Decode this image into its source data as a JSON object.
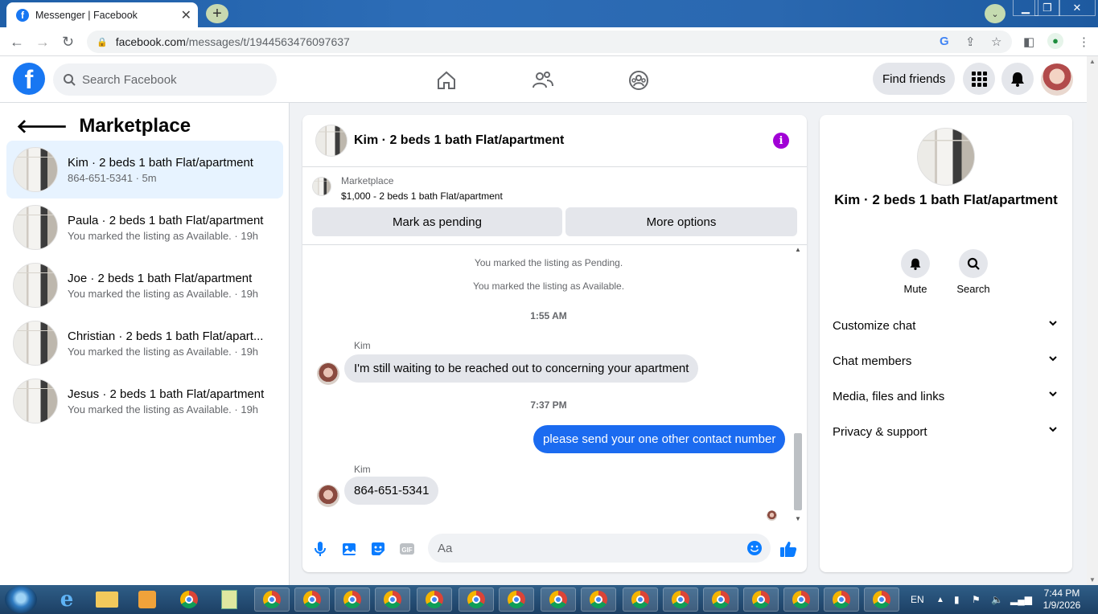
{
  "browser": {
    "tab_title": "Messenger | Facebook",
    "url_host": "facebook.com",
    "url_path": "/messages/t/1944563476097637"
  },
  "header": {
    "search_placeholder": "Search Facebook",
    "find_friends": "Find friends"
  },
  "sidebar": {
    "title": "Marketplace",
    "conversations": [
      {
        "name": "Kim · 2 beds 1 bath Flat/apartment",
        "sub": "864-651-5341 · 5m",
        "active": true
      },
      {
        "name": "Paula · 2 beds 1 bath Flat/apartment",
        "sub": "You marked the listing as Available. · 19h"
      },
      {
        "name": "Joe · 2 beds 1 bath Flat/apartment",
        "sub": "You marked the listing as Available. · 19h"
      },
      {
        "name": "Christian · 2 beds 1 bath Flat/apart...",
        "sub": "You marked the listing as Available. · 19h"
      },
      {
        "name": "Jesus · 2 beds 1 bath Flat/apartment",
        "sub": "You marked the listing as Available. · 19h"
      }
    ]
  },
  "chat": {
    "title": "Kim · 2 beds 1 bath Flat/apartment",
    "listing_label": "Marketplace",
    "listing_detail": "$1,000 - 2 beds 1 bath Flat/apartment",
    "mark_pending": "Mark as pending",
    "more_options": "More options",
    "sys1": "You marked the listing as Pending.",
    "sys2": "You marked the listing as Available.",
    "time1": "1:55 AM",
    "sender1": "Kim",
    "msg1": "I'm still waiting to be reached out to concerning your apartment",
    "time2": "7:37 PM",
    "msg2": "please send your one other contact number",
    "sender2": "Kim",
    "msg3": "864-651-5341",
    "composer_placeholder": "Aa"
  },
  "details": {
    "title": "Kim · 2 beds 1 bath Flat/apartment",
    "mute": "Mute",
    "search": "Search",
    "rows": [
      "Customize chat",
      "Chat members",
      "Media, files and links",
      "Privacy & support"
    ]
  },
  "taskbar": {
    "lang": "EN",
    "time": "7:44 PM",
    "date": "1/9/2026"
  },
  "colors": {
    "fb_blue": "#1877f2",
    "bubble_out": "#1b6bf0",
    "active_row": "#e7f3ff",
    "info_purple": "#a100d6"
  }
}
